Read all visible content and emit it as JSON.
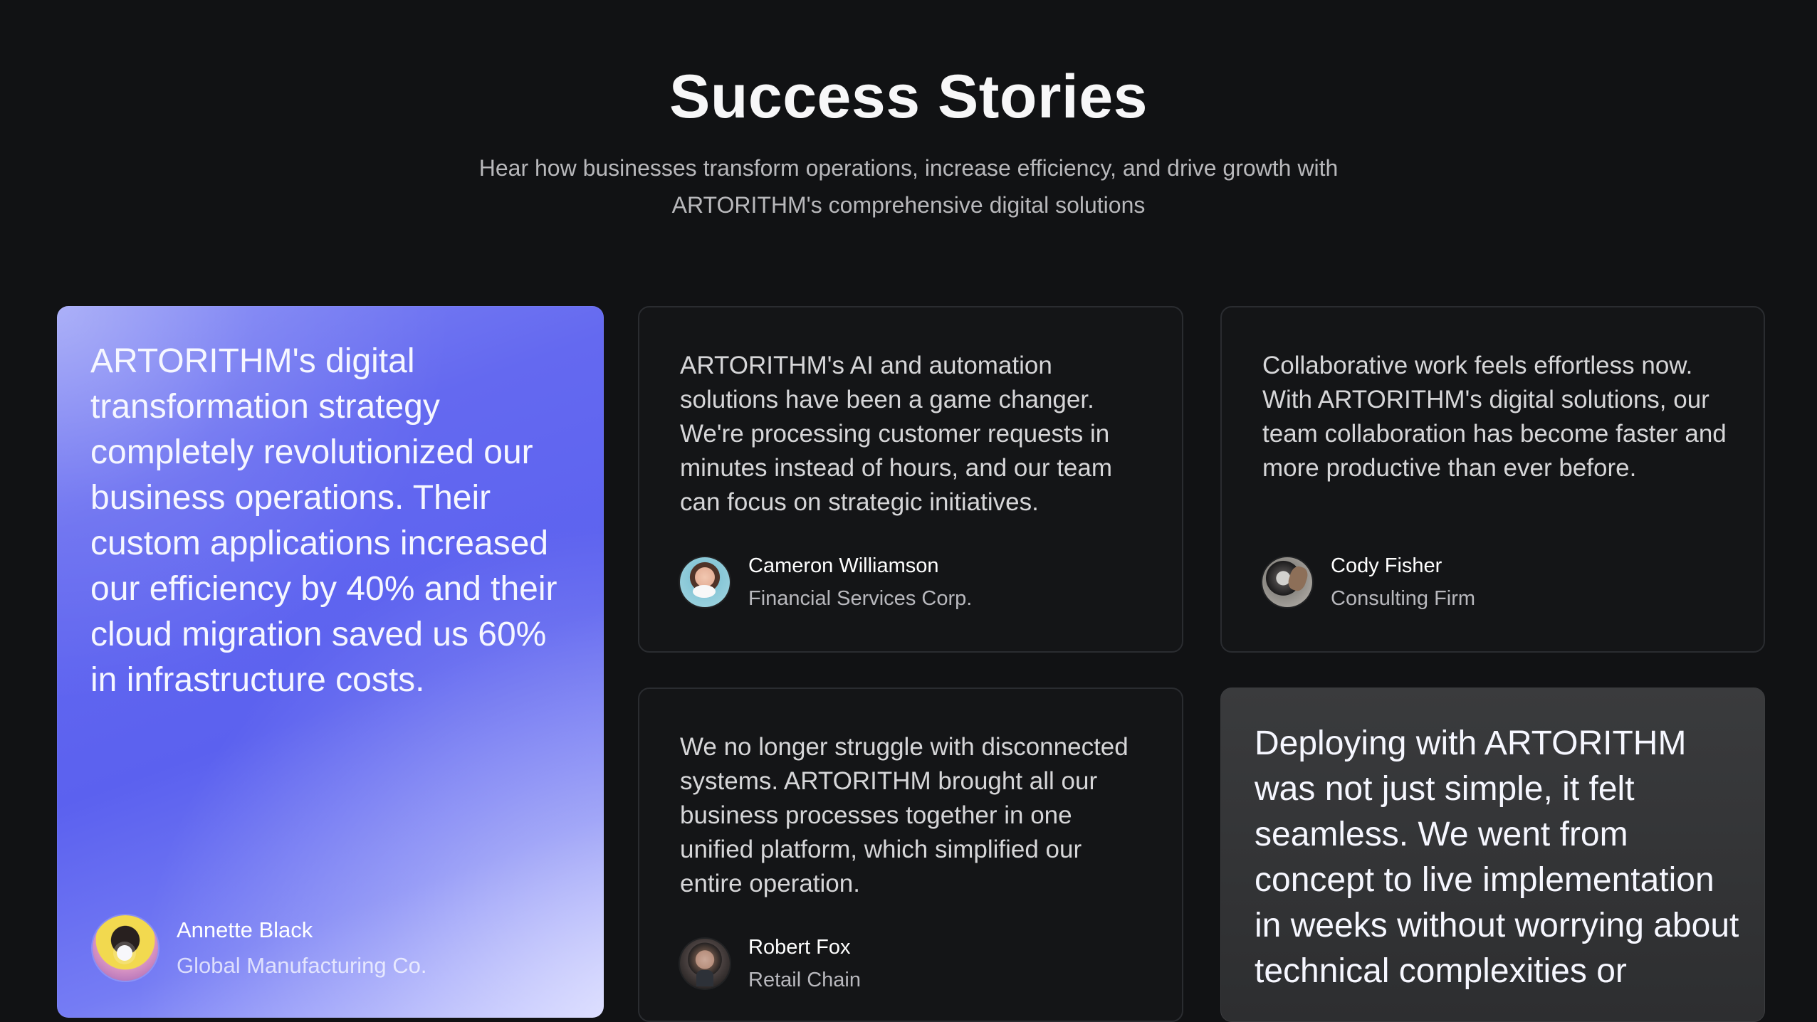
{
  "page": {
    "title": "Success Stories",
    "subtitle": "Hear how businesses transform operations, increase efficiency,\nand drive growth with ARTORITHM's comprehensive digital solutions"
  },
  "cards": [
    {
      "quote": "ARTORITHM's digital transformation strategy completely revolutionized our business operations. Their custom applications increased our efficiency by 40% and their cloud migration saved us 60% in infrastructure costs.",
      "name": "Annette Black",
      "company": "Global Manufacturing Co."
    },
    {
      "quote": "ARTORITHM's AI and automation solutions have been a game changer. We're processing customer requests in minutes instead of hours, and our team can focus on strategic initiatives.",
      "name": "Cameron Williamson",
      "company": "Financial Services Corp."
    },
    {
      "quote": "Collaborative work feels effortless now. With ARTORITHM's digital solutions, our team collaboration has become faster and more productive than ever before.",
      "name": "Cody Fisher",
      "company": "Consulting Firm"
    },
    {
      "quote": "We no longer struggle with disconnected systems. ARTORITHM brought all our business processes together in one unified platform, which simplified our entire operation.",
      "name": "Robert Fox",
      "company": "Retail Chain"
    },
    {
      "quote": "Deploying with ARTORITHM was not just simple, it felt seamless. We went from concept to live implementation in weeks without worrying about technical complexities or"
    }
  ],
  "icons": {
    "avatar_1": "avatar",
    "avatar_2": "avatar",
    "avatar_3": "avatar",
    "avatar_4": "avatar"
  },
  "colors": {
    "background": "#111214",
    "card": "#141517",
    "accent": "#5b61ef"
  }
}
